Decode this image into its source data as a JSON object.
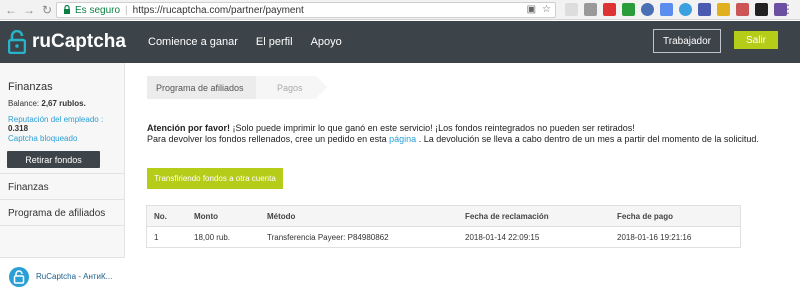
{
  "browser": {
    "secure_label": "Es seguro",
    "url": "https://rucaptcha.com/partner/payment"
  },
  "header": {
    "brand": "ruCaptcha",
    "nav": [
      "Comience a ganar",
      "El perfil",
      "Apoyo"
    ],
    "worker_button": "Trabajador",
    "exit_button": "Salir",
    "accent_color": "#b5cc18",
    "bar_color": "#3d4449"
  },
  "sidebar": {
    "title": "Finanzas",
    "balance_label": "Balance:",
    "balance_value": "2,67 rublos.",
    "reputation_label": "Reputación del empleado :",
    "reputation_value": "0.318",
    "captcha_blocked": "Captcha bloqueado",
    "withdraw_button": "Retirar fondos",
    "links": [
      "Finanzas",
      "Programa de afiliados"
    ],
    "app_label": "RuCaptcha - АнтиК..."
  },
  "breadcrumb": [
    "Programa de afiliados",
    "Pagos"
  ],
  "notice": {
    "bold": "Atención por favor!",
    "line1_rest": " ¡Solo puede imprimir lo que ganó en este servicio! ¡Los fondos reintegrados no pueden ser retirados!",
    "line2_pre": "Para devolver los fondos rellenados, cree un pedido en esta ",
    "line2_link": "página",
    "line2_post": " . La devolución se lleva a cabo dentro de un mes a partir del momento de la solicitud."
  },
  "transfer_button": "Transfiriendo fondos a otra cuenta",
  "table": {
    "headers": [
      "No.",
      "Monto",
      "Método",
      "Fecha de reclamación",
      "Fecha de pago"
    ],
    "rows": [
      [
        "1",
        "18,00 rub.",
        "Transferencia Payeer: P84980862",
        "2018-01-14 22:09:15",
        "2018-01-16 19:21:16"
      ]
    ]
  }
}
